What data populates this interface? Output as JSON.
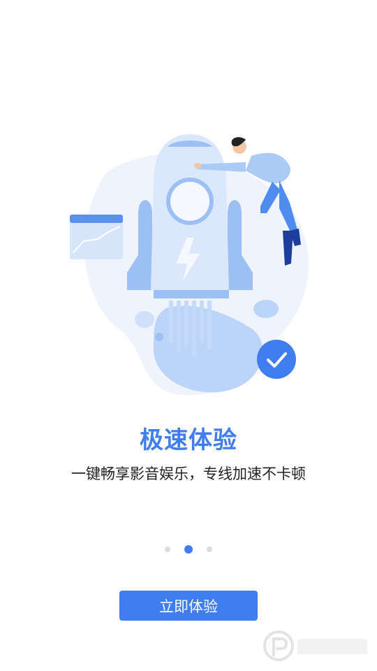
{
  "onboarding": {
    "title": "极速体验",
    "subtitle": "一键畅享影音娱乐，专线加速不卡顿",
    "pager": {
      "total": 3,
      "active_index": 1
    },
    "cta_label": "立即体验"
  },
  "colors": {
    "accent": "#3f7df0",
    "illustration_bg": "#eef3fc",
    "rocket_body": "#dbe7fb",
    "rocket_fins": "#9dc0f4"
  },
  "icons": {
    "checkmark": "check-circle-icon",
    "lightning": "lightning-bolt-icon",
    "chart": "line-chart-card-icon"
  }
}
